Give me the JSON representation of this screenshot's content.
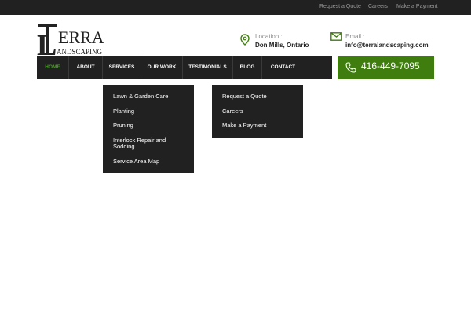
{
  "topbar": {
    "links": [
      "Request a Quote",
      "Careers",
      "Make a Payment"
    ]
  },
  "logo": {
    "big_letter": "L",
    "word_top": "ERRA",
    "word_bottom": "ANDSCAPING",
    "accent_color": "#3f7e0e"
  },
  "contact": {
    "location_label": "Location :",
    "location_value": "Don Mills, Ontario",
    "email_label": "Email :",
    "email_value": "info@terralandscaping.com",
    "phone": "416-449-7095"
  },
  "nav": {
    "items": [
      "Home",
      "About",
      "Services",
      "Our Work",
      "Testimonials",
      "Blog",
      "Contact"
    ],
    "active": "Home"
  },
  "services_menu": [
    "Lawn & Garden Care",
    "Planting",
    "Pruning",
    "Interlock Repair and Sodding",
    "Service Area Map"
  ],
  "quote_menu": [
    "Request a Quote",
    "Careers",
    "Make a Payment"
  ],
  "colors": {
    "dark": "#212121",
    "green": "#3f7e0e",
    "active_nav": "#4a9a2a"
  }
}
